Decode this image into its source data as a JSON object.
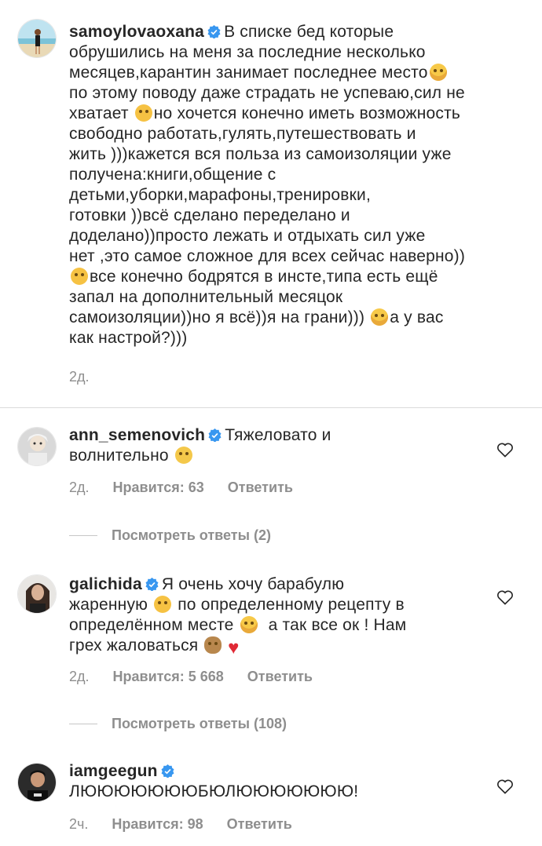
{
  "comments": [
    {
      "username": "samoylovaoxana",
      "verified": true,
      "text_1": "В списке бед которые\nобрушились на меня за последние несколько\nмесяцев,карантин занимает последнее место",
      "text_2": "\nпо этому поводу даже страдать не успеваю,сил не\nхватает ",
      "text_3": "но хочется конечно иметь возможность\nсвободно работать,гулять,путешествовать и\nжить )))кажется вся польза из самоизоляции уже\nполучена:книги,общение с\nдетьми,уборки,марафоны,тренировки,\nготовки ))всё сделано переделано и\nдоделано))просто лежать и отдыхать сил уже\nнет ,это самое сложное для всех сейчас наверно))\n",
      "text_4": "все конечно бодрятся в инсте,типа есть ещё\nзапал на дополнительный месяцок\nсамоизоляции))но я всё))я на грани))) ",
      "text_5": "а у вас\nкак настрой?)))",
      "time": "2д."
    },
    {
      "username": "ann_semenovich",
      "verified": true,
      "text_1": "Тяжеловато и\nволнительно ",
      "time": "2д.",
      "likes": "Нравится: 63",
      "reply": "Ответить",
      "view_replies": "Посмотреть ответы (2)"
    },
    {
      "username": "galichida",
      "verified": true,
      "text_1": "Я очень хочу барабулю\nжаренную ",
      "text_2": " по определенному рецепту в\nопределённом месте ",
      "text_3": "  а так все ок ! Нам\nгрех жаловаться ",
      "time": "2д.",
      "likes": "Нравится: 5 668",
      "reply": "Ответить",
      "view_replies": "Посмотреть ответы (108)"
    },
    {
      "username": "iamgeegun",
      "verified": true,
      "text_1": "ЛЮЮЮЮЮЮЮБЮЛЮЮЮЮЮЮЮ!",
      "time": "2ч.",
      "likes": "Нравится: 98",
      "reply": "Ответить"
    }
  ],
  "colors": {
    "text": "#262626",
    "muted": "#8e8e8e",
    "verified": "#3897f0",
    "divider": "#dbdbdb"
  },
  "icons": {
    "verified": "verified-badge-icon",
    "like": "heart-outline-icon"
  }
}
